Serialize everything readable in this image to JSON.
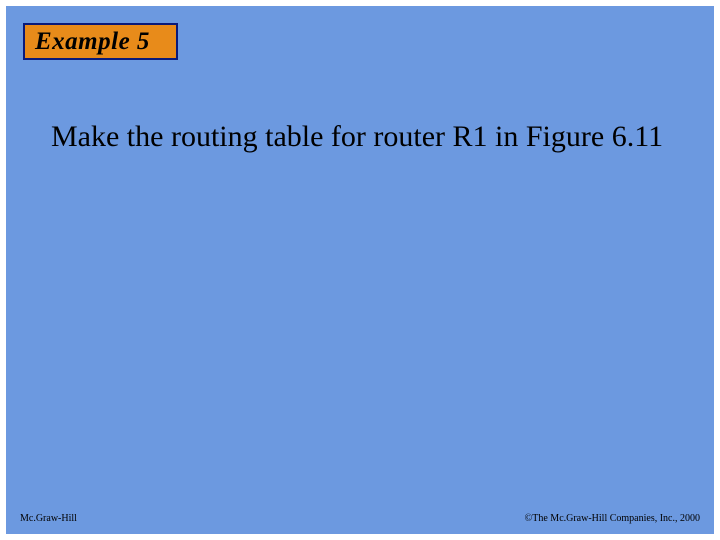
{
  "badge": {
    "label": "Example 5"
  },
  "body": {
    "text": "Make the routing table for router R1 in Figure 6.11"
  },
  "footer": {
    "left": "Mc.Graw-Hill",
    "right": "©The Mc.Graw-Hill Companies, Inc., 2000"
  }
}
